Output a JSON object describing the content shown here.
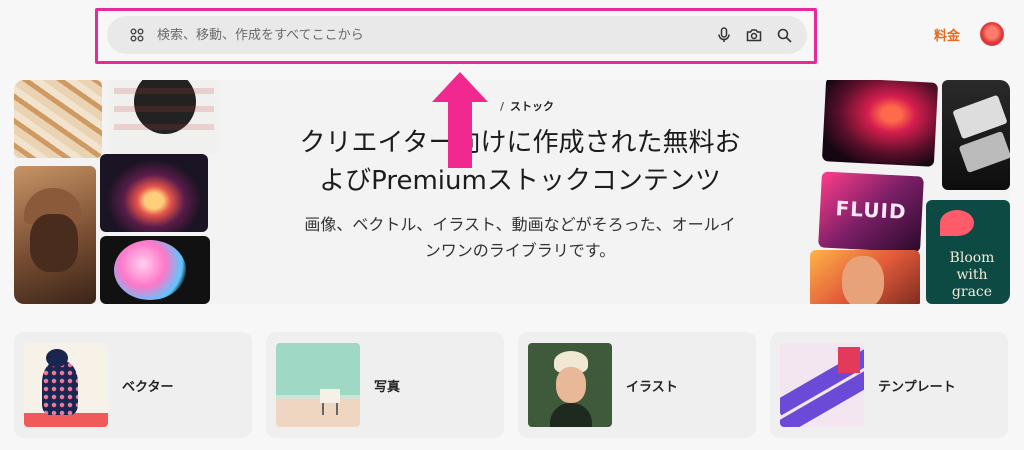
{
  "header": {
    "search": {
      "placeholder": "検索、移動、作成をすべてここから",
      "value": ""
    },
    "pricing_label": "料金",
    "icons": [
      "apps-icon",
      "microphone-icon",
      "camera-icon",
      "search-icon"
    ]
  },
  "hero": {
    "breadcrumb_sep": "/",
    "breadcrumb_label": "ストック",
    "title_line1": "クリエイター向けに作成された無料お",
    "title_line2": "よびPremiumストックコンテンツ",
    "subtitle_line1": "画像、ベクトル、イラスト、動画などがそろった、オールイ",
    "subtitle_line2": "ンワンのライブラリです。",
    "tile_fluid_text": "FLUID",
    "tile_bloom_text_1": "Bloom",
    "tile_bloom_text_2": "with",
    "tile_bloom_text_3": "grace"
  },
  "categories": [
    {
      "label": "ベクター"
    },
    {
      "label": "写真"
    },
    {
      "label": "イラスト"
    },
    {
      "label": "テンプレート"
    }
  ],
  "colors": {
    "highlight": "#e8299b",
    "pricing": "#e86a1a",
    "arrow": "#f0288f"
  }
}
